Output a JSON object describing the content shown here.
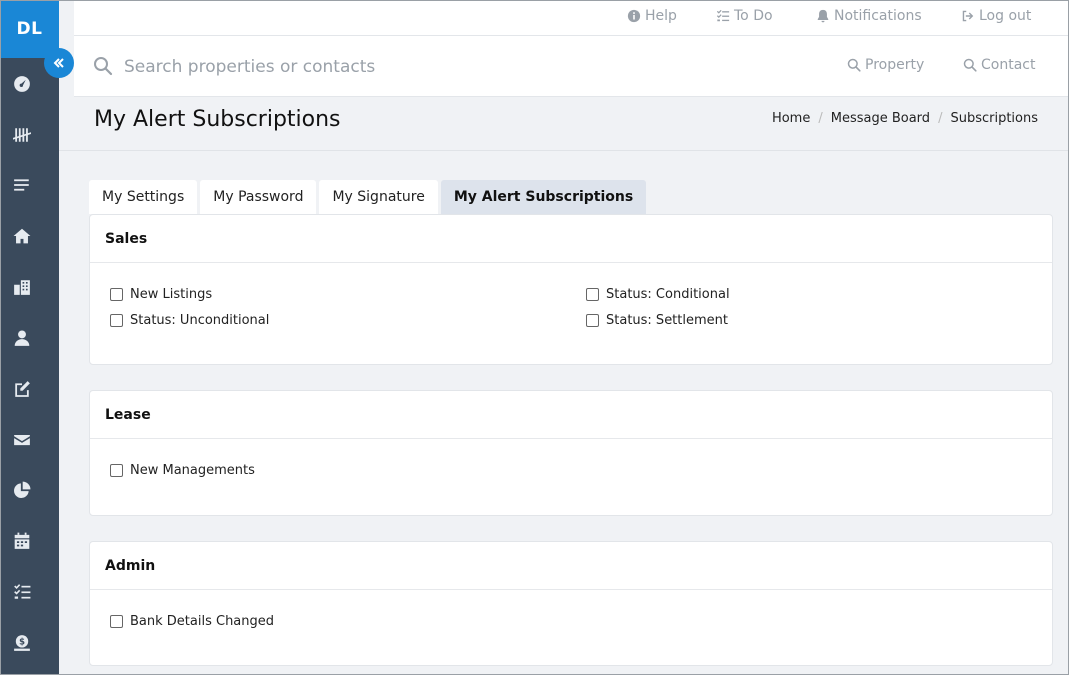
{
  "app": {
    "logo_initials": "DL",
    "colors": {
      "sidebar": "#3a4a5c",
      "accent": "#1a87d6",
      "tab_active": "#dde3ec"
    }
  },
  "sidebar": {
    "items": [
      {
        "icon": "dashboard-gauge-icon"
      },
      {
        "icon": "tally-icon"
      },
      {
        "icon": "list-icon"
      },
      {
        "icon": "home-icon"
      },
      {
        "icon": "building-icon"
      },
      {
        "icon": "user-icon"
      },
      {
        "icon": "edit-icon"
      },
      {
        "icon": "envelope-icon"
      },
      {
        "icon": "pie-chart-icon"
      },
      {
        "icon": "calendar-icon"
      },
      {
        "icon": "tasks-icon"
      },
      {
        "icon": "money-icon"
      }
    ]
  },
  "topbar": {
    "help": "Help",
    "todo": "To Do",
    "notifications": "Notifications",
    "logout": "Log out"
  },
  "search": {
    "placeholder": "Search properties or contacts",
    "property": "Property",
    "contact": "Contact"
  },
  "header": {
    "title": "My Alert Subscriptions",
    "breadcrumb": [
      "Home",
      "Message Board",
      "Subscriptions"
    ]
  },
  "tabs": [
    "My Settings",
    "My Password",
    "My Signature",
    "My Alert Subscriptions"
  ],
  "panels": {
    "sales": {
      "title": "Sales",
      "options": [
        "New Listings",
        "Status: Unconditional",
        "Status: Conditional",
        "Status: Settlement"
      ]
    },
    "lease": {
      "title": "Lease",
      "options": [
        "New Managements"
      ]
    },
    "admin": {
      "title": "Admin",
      "options": [
        "Bank Details Changed"
      ]
    }
  }
}
